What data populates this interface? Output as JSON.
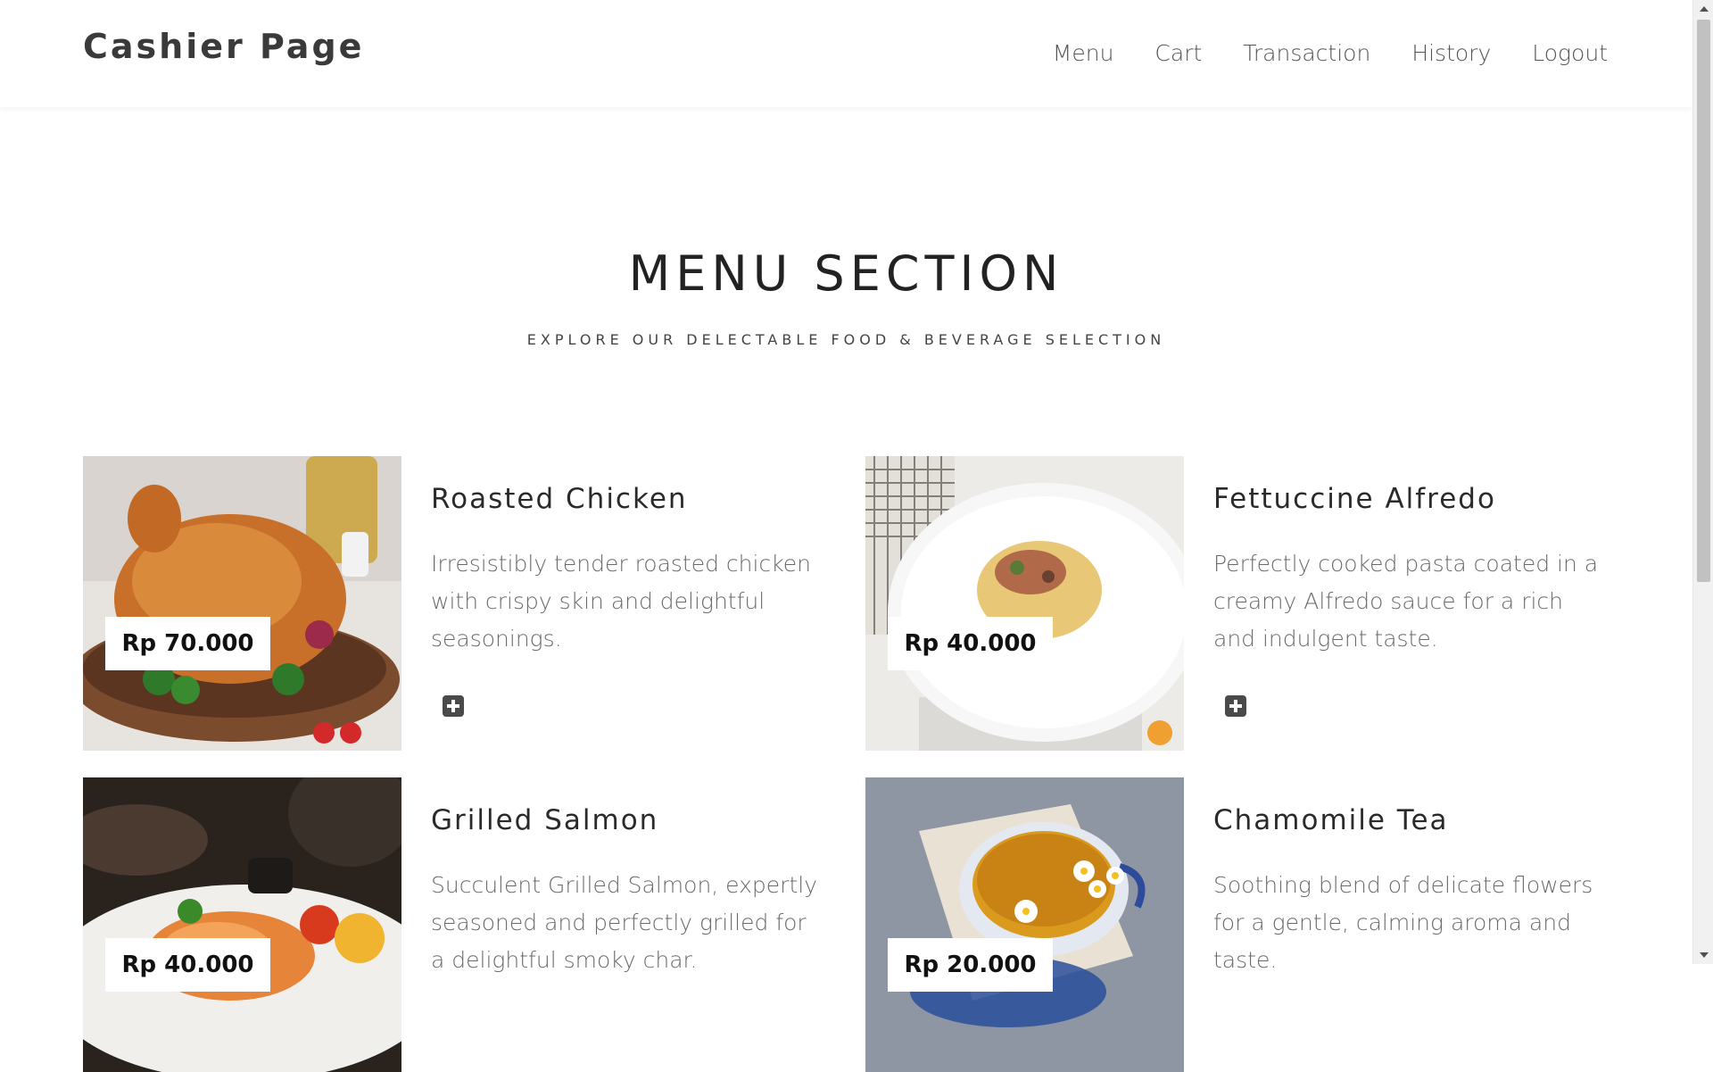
{
  "header": {
    "brand": "Cashier Page",
    "nav": [
      "Menu",
      "Cart",
      "Transaction",
      "History",
      "Logout"
    ]
  },
  "section": {
    "title": "MENU SECTION",
    "subtitle": "EXPLORE OUR DELECTABLE FOOD & BEVERAGE SELECTION"
  },
  "items": [
    {
      "name": "Roasted Chicken",
      "price": "Rp 70.000",
      "description": "Irresistibly tender roasted chicken with crispy skin and delightful seasonings.",
      "image": "roasted-chicken-photo"
    },
    {
      "name": "Fettuccine Alfredo",
      "price": "Rp 40.000",
      "description": "Perfectly cooked pasta coated in a creamy Alfredo sauce for a rich and indulgent taste.",
      "image": "fettuccine-photo"
    },
    {
      "name": "Grilled Salmon",
      "price": "Rp 40.000",
      "description": "Succulent Grilled Salmon, expertly seasoned and perfectly grilled for a delightful smoky char.",
      "image": "grilled-salmon-photo"
    },
    {
      "name": "Chamomile Tea",
      "price": "Rp 20.000",
      "description": "Soothing blend of delicate flowers for a gentle, calming aroma and taste.",
      "image": "chamomile-tea-photo"
    }
  ],
  "colors": {
    "text_dark": "#222222",
    "text_muted": "#6a6a6a",
    "button": "#4a4a4a",
    "background": "#ffffff"
  },
  "icons": {
    "add": "plus-square-icon",
    "scroll_up": "triangle-up-icon",
    "scroll_down": "triangle-down-icon"
  }
}
